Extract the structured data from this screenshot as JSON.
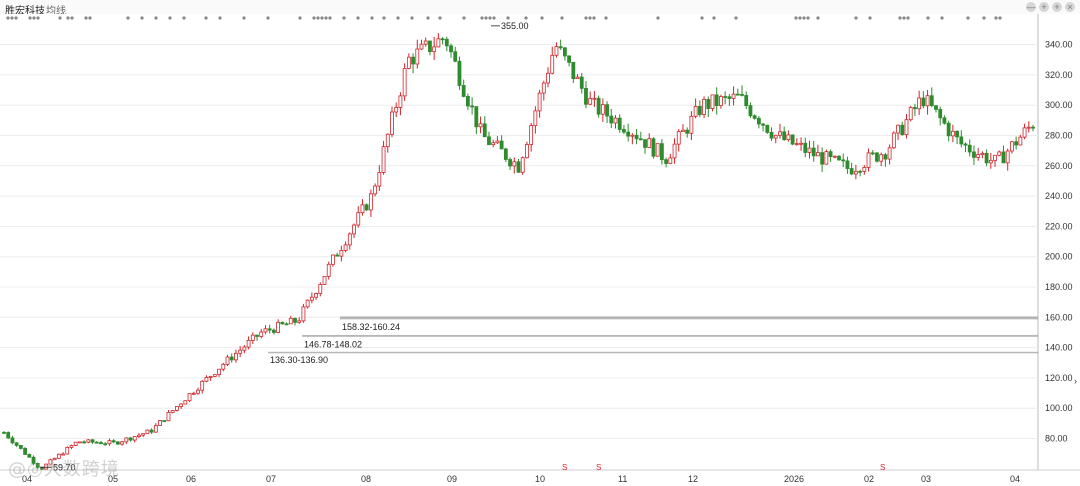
{
  "window": {
    "title": "胜宏科技",
    "tab": "均线",
    "controls": [
      "—",
      "+",
      "+",
      "×"
    ]
  },
  "watermark": "@◎大数跨境",
  "chart_data": {
    "type": "candlestick",
    "title": "",
    "ylim": [
      60,
      360
    ],
    "y_ticks": [
      "80.00",
      "100.00",
      "120.00",
      "140.00",
      "160.00",
      "180.00",
      "200.00",
      "220.00",
      "240.00",
      "260.00",
      "280.00",
      "300.00",
      "320.00",
      "340.00"
    ],
    "x_ticks": [
      "04",
      "05",
      "06",
      "07",
      "08",
      "09",
      "10",
      "11",
      "12",
      "2026",
      "02",
      "03",
      "04"
    ],
    "annotations": [
      {
        "text": "355.00",
        "value": 355.0
      },
      {
        "text": "59.70",
        "value": 59.7
      },
      {
        "text": "158.32-160.24",
        "low": 158.32,
        "high": 160.24
      },
      {
        "text": "146.78-148.02",
        "low": 146.78,
        "high": 148.02
      },
      {
        "text": "136.30-136.90",
        "low": 136.3,
        "high": 136.9
      }
    ],
    "s_markers": [
      "S",
      "S",
      "S"
    ],
    "up_color": "#d0252b",
    "down_color": "#2e8b2e",
    "price_path": [
      [
        "04",
        84
      ],
      [
        "04",
        60
      ],
      [
        "05",
        78
      ],
      [
        "05",
        77
      ],
      [
        "06",
        85
      ],
      [
        "06",
        108
      ],
      [
        "07",
        130
      ],
      [
        "07",
        150
      ],
      [
        "08",
        158
      ],
      [
        "08",
        200
      ],
      [
        "09",
        240
      ],
      [
        "09",
        330
      ],
      [
        "09",
        345
      ],
      [
        "10",
        280
      ],
      [
        "10",
        260
      ],
      [
        "11",
        340
      ],
      [
        "11",
        300
      ],
      [
        "11",
        285
      ],
      [
        "12",
        265
      ],
      [
        "12",
        300
      ],
      [
        "2026",
        305
      ],
      [
        "2026",
        280
      ],
      [
        "2026",
        268
      ],
      [
        "02",
        258
      ],
      [
        "02",
        270
      ],
      [
        "03",
        305
      ],
      [
        "03",
        275
      ],
      [
        "04",
        262
      ],
      [
        "04",
        288
      ]
    ]
  }
}
